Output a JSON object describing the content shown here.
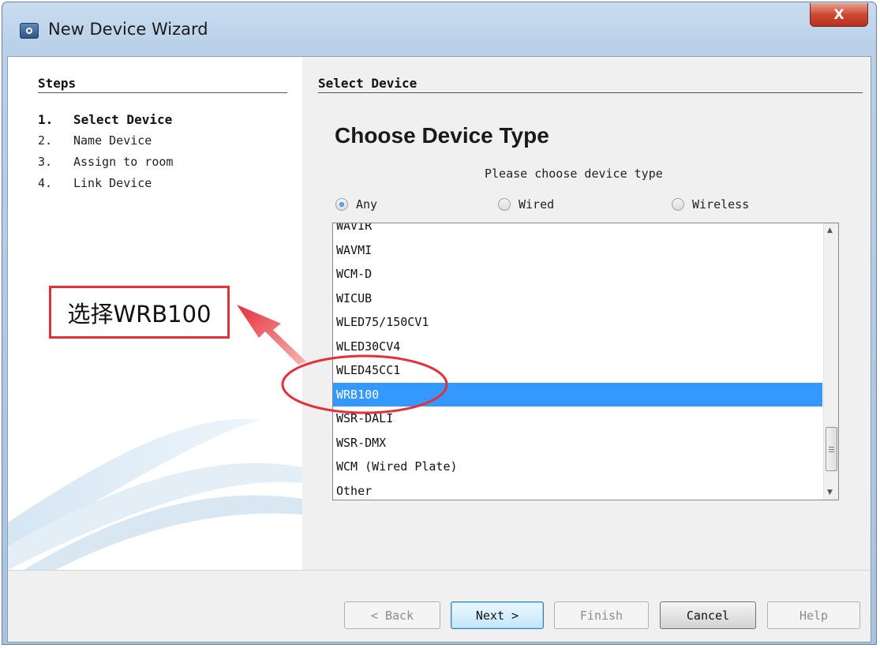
{
  "window": {
    "title": "New Device Wizard",
    "close_label": "X"
  },
  "steps_panel": {
    "header": "Steps",
    "items": [
      {
        "num": "1.",
        "label": "Select Device",
        "active": true
      },
      {
        "num": "2.",
        "label": "Name Device",
        "active": false
      },
      {
        "num": "3.",
        "label": "Assign to room",
        "active": false
      },
      {
        "num": "4.",
        "label": "Link Device",
        "active": false
      }
    ]
  },
  "content": {
    "header": "Select Device",
    "title": "Choose Device Type",
    "subtitle": "Please choose device type",
    "radio": {
      "any": "Any",
      "wired": "Wired",
      "wireless": "Wireless",
      "selected": "Any"
    },
    "device_list": [
      "WAVIR",
      "WAVMI",
      "WCM-D",
      "WICUB",
      "WLED75/150CV1",
      "WLED30CV4",
      "WLED45CC1",
      "WRB100",
      "WSR-DALI",
      "WSR-DMX",
      "WCM (Wired Plate)",
      "Other"
    ],
    "selected_device": "WRB100"
  },
  "buttons": {
    "back": "< Back",
    "next": "Next >",
    "finish": "Finish",
    "cancel": "Cancel",
    "help": "Help"
  },
  "annotation": {
    "callout_text": "选择WRB100",
    "color": "#e5303a"
  },
  "colors": {
    "selection": "#3399ff",
    "title_gradient": "#b9d0e8"
  }
}
